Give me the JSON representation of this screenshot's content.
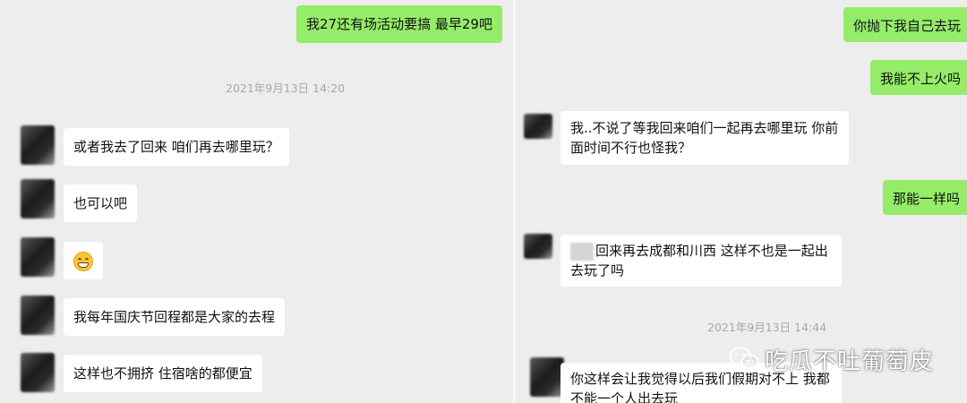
{
  "left_chat": {
    "messages": [
      {
        "side": "sent",
        "text": "我27还有场活动要搞 最早29吧"
      },
      {
        "side": "received",
        "text": "或者我去了回来 咱们再去哪里玩？"
      },
      {
        "side": "received",
        "text": "也可以吧"
      },
      {
        "side": "received",
        "text": "",
        "emoji": "grimacing-face-emoji"
      },
      {
        "side": "received",
        "text": "我每年国庆节回程都是大家的去程"
      },
      {
        "side": "received",
        "text": "这样也不拥挤 住宿啥的都便宜"
      }
    ],
    "timestamp": "2021年9月13日 14:20"
  },
  "right_chat": {
    "messages": [
      {
        "side": "sent",
        "text": "你抛下我自己去玩"
      },
      {
        "side": "sent",
        "text": "我能不上火吗"
      },
      {
        "side": "received",
        "text": "我..不说了等我回来咱们一起再去哪里玩 你前面时间不行也怪我？"
      },
      {
        "side": "sent",
        "text": "那能一样吗"
      },
      {
        "side": "received",
        "text": "回来再去成都和川西 这样不也是一起出去玩了吗"
      },
      {
        "side": "received",
        "text": "你这样会让我觉得以后我们假期对不上 我都不能一个人出去玩"
      }
    ],
    "timestamp": "2021年9月13日 14:44"
  },
  "watermark": {
    "text": "吃瓜不吐葡萄皮",
    "icon": "wechat-logo-icon"
  },
  "colors": {
    "sent_bubble": "#95ec69",
    "received_bubble": "#ffffff",
    "background": "#ededed",
    "timestamp": "#a8a8a8"
  }
}
